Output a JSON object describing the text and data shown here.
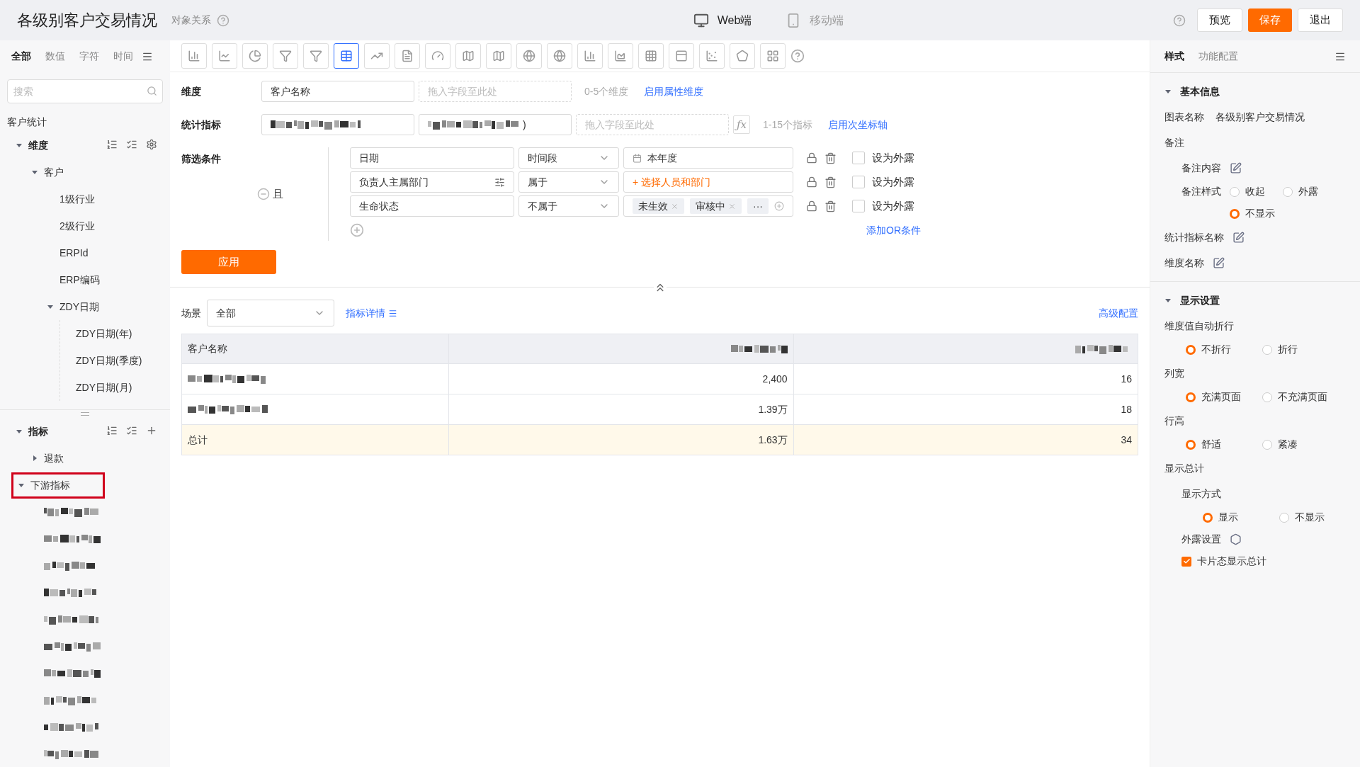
{
  "header": {
    "title": "各级别客户交易情况",
    "relation": "对象关系",
    "devices": [
      {
        "kind": "desktop",
        "label": "Web端",
        "selected": true
      },
      {
        "kind": "mobile",
        "label": "移动端",
        "selected": false
      }
    ],
    "buttons": [
      {
        "kind": "default",
        "label": "预览"
      },
      {
        "kind": "primary",
        "label": "保存"
      },
      {
        "kind": "default",
        "label": "退出"
      }
    ]
  },
  "sidebar": {
    "tabs": [
      {
        "label": "全部",
        "selected": true
      },
      {
        "label": "数值",
        "selected": false
      },
      {
        "label": "字符",
        "selected": false
      },
      {
        "label": "时间",
        "selected": false
      }
    ],
    "search": {
      "placeholder": "搜索"
    },
    "group": "客户统计",
    "dimensions": {
      "label": "维度",
      "expanded": true,
      "children": [
        {
          "label": "客户",
          "expanded": true,
          "children": [
            {
              "label": "1级行业"
            },
            {
              "label": "2级行业"
            },
            {
              "label": "ERPId"
            },
            {
              "label": "ERP编码"
            },
            {
              "label": "ZDY日期",
              "expanded": true,
              "children": [
                {
                  "label": "ZDY日期(年)"
                },
                {
                  "label": "ZDY日期(季度)"
                },
                {
                  "label": "ZDY日期(月)"
                }
              ]
            }
          ]
        }
      ]
    },
    "metrics": {
      "label": "指标",
      "expanded": true,
      "children": [
        {
          "label": "退款",
          "expanded": false,
          "highlighted": false
        },
        {
          "label": "下游指标",
          "expanded": true,
          "highlighted": true,
          "children": [
            {
              "kind": "redacted"
            },
            {
              "kind": "redacted"
            },
            {
              "kind": "redacted"
            },
            {
              "kind": "redacted"
            },
            {
              "kind": "redacted"
            },
            {
              "kind": "redacted"
            },
            {
              "kind": "redacted"
            },
            {
              "kind": "redacted"
            },
            {
              "kind": "redacted"
            },
            {
              "kind": "redacted"
            }
          ]
        }
      ]
    }
  },
  "chart_types": [
    {
      "kind": "bar",
      "selected": false
    },
    {
      "kind": "line",
      "selected": false
    },
    {
      "kind": "pie",
      "selected": false
    },
    {
      "kind": "funnel",
      "selected": false
    },
    {
      "kind": "funnel",
      "selected": false
    },
    {
      "kind": "table",
      "selected": true
    },
    {
      "kind": "combo",
      "selected": false
    },
    {
      "kind": "text",
      "selected": false
    },
    {
      "kind": "gauge",
      "selected": false
    },
    {
      "kind": "map",
      "selected": false
    },
    {
      "kind": "map",
      "selected": false
    },
    {
      "kind": "globe",
      "selected": false
    },
    {
      "kind": "globe",
      "selected": false
    },
    {
      "kind": "bar",
      "selected": false
    },
    {
      "kind": "area",
      "selected": false
    },
    {
      "kind": "heatmap",
      "selected": false
    },
    {
      "kind": "pivot",
      "selected": false
    },
    {
      "kind": "scatter",
      "selected": false
    },
    {
      "kind": "radar",
      "selected": false
    },
    {
      "kind": "grid",
      "selected": false
    }
  ],
  "dimension": {
    "label": "维度",
    "fields": [
      {
        "kind": "text",
        "text": "客户名称"
      }
    ],
    "placeholder": "拖入字段至此处",
    "hint": "0-5个维度",
    "link": "启用属性维度"
  },
  "metric": {
    "label": "统计指标",
    "fields": [
      {
        "kind": "redacted"
      },
      {
        "kind": "redacted",
        "text": ")"
      }
    ],
    "placeholder": "拖入字段至此处",
    "formula": "ƒx",
    "hint": "1-15个指标",
    "link": "启用次坐标轴"
  },
  "filters": {
    "label": "筛选条件",
    "logic": "且",
    "conditions": [
      {
        "field": "日期",
        "field_icon": false,
        "operator": "时间段",
        "value": {
          "kind": "date",
          "text": "本年度"
        },
        "expose": {
          "label": "设为外露",
          "checked": false
        }
      },
      {
        "field": "负责人主属部门",
        "field_icon": true,
        "operator": "属于",
        "value": {
          "kind": "picker",
          "text": "+ 选择人员和部门"
        },
        "expose": {
          "label": "设为外露",
          "checked": false
        }
      },
      {
        "field": "生命状态",
        "field_icon": false,
        "operator": "不属于",
        "value": {
          "kind": "tags",
          "tags": [
            "未生效",
            "审核中"
          ],
          "more": "···"
        },
        "expose": {
          "label": "设为外露",
          "checked": false
        }
      }
    ],
    "or_link": "添加OR条件"
  },
  "apply": "应用",
  "scene": {
    "label": "场景",
    "value": "全部",
    "details": "指标详情",
    "advanced": "高级配置"
  },
  "table": {
    "columns": [
      {
        "kind": "text",
        "text": "客户名称"
      },
      {
        "kind": "redacted"
      },
      {
        "kind": "redacted"
      }
    ],
    "rows": [
      {
        "kind": "data",
        "cells": [
          {
            "kind": "redacted"
          },
          {
            "kind": "text",
            "text": "2,400"
          },
          {
            "kind": "text",
            "text": "16"
          }
        ]
      },
      {
        "kind": "data",
        "cells": [
          {
            "kind": "redacted"
          },
          {
            "kind": "text",
            "text": "1.39万"
          },
          {
            "kind": "text",
            "text": "18"
          }
        ]
      },
      {
        "kind": "total",
        "cells": [
          {
            "kind": "text",
            "text": "总计"
          },
          {
            "kind": "text",
            "text": "1.63万"
          },
          {
            "kind": "text",
            "text": "34"
          }
        ]
      }
    ]
  },
  "panel": {
    "tabs": [
      {
        "label": "样式",
        "selected": true
      },
      {
        "label": "功能配置",
        "selected": false
      }
    ],
    "sections": [
      {
        "title": "基本信息",
        "expanded": true,
        "rows": [
          {
            "kind": "field",
            "label": "图表名称",
            "value": "各级别客户交易情况"
          },
          {
            "kind": "group",
            "label": "备注",
            "children": [
              {
                "kind": "edit",
                "label": "备注内容"
              },
              {
                "kind": "radio",
                "label": "备注样式",
                "options": [
                  {
                    "label": "收起",
                    "selected": false
                  },
                  {
                    "label": "外露",
                    "selected": false
                  },
                  {
                    "label": "不显示",
                    "selected": true
                  }
                ]
              }
            ]
          },
          {
            "kind": "edit",
            "label": "统计指标名称"
          },
          {
            "kind": "edit",
            "label": "维度名称"
          }
        ]
      },
      {
        "title": "显示设置",
        "expanded": true,
        "rows": [
          {
            "kind": "group",
            "label": "维度值自动折行",
            "children": [
              {
                "kind": "radio",
                "options": [
                  {
                    "label": "不折行",
                    "selected": true
                  },
                  {
                    "label": "折行",
                    "selected": false
                  }
                ]
              }
            ]
          },
          {
            "kind": "group",
            "label": "列宽",
            "children": [
              {
                "kind": "radio",
                "options": [
                  {
                    "label": "充满页面",
                    "selected": true
                  },
                  {
                    "label": "不充满页面",
                    "selected": false
                  }
                ]
              }
            ]
          },
          {
            "kind": "group",
            "label": "行高",
            "children": [
              {
                "kind": "radio",
                "options": [
                  {
                    "label": "舒适",
                    "selected": true
                  },
                  {
                    "label": "紧凑",
                    "selected": false
                  }
                ]
              }
            ]
          },
          {
            "kind": "group",
            "label": "显示总计",
            "children": [
              {
                "kind": "group",
                "label": "显示方式",
                "children": [
                  {
                    "kind": "radio",
                    "options": [
                      {
                        "label": "显示",
                        "selected": true
                      },
                      {
                        "label": "不显示",
                        "selected": false
                      }
                    ]
                  }
                ]
              },
              {
                "kind": "gear",
                "label": "外露设置"
              },
              {
                "kind": "checkbox",
                "label": "卡片态显示总计",
                "checked": true
              }
            ]
          }
        ]
      }
    ]
  }
}
